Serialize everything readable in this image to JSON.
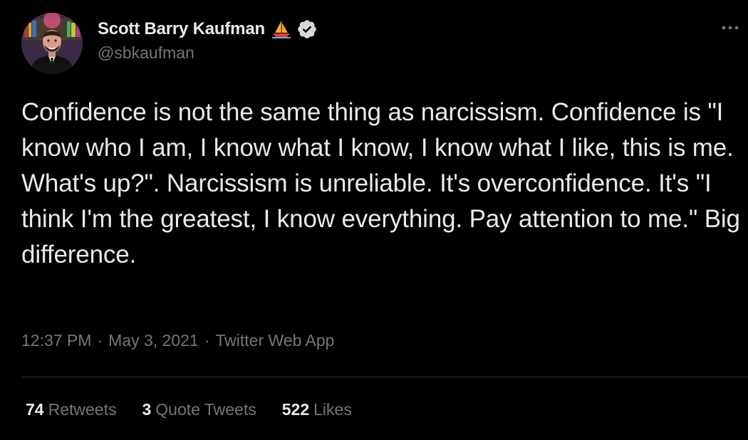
{
  "author": {
    "display_name": "Scott Barry Kaufman",
    "handle": "@sbkaufman",
    "name_emoji_icon": "sailboat-icon",
    "verified_icon": "verified-badge-icon"
  },
  "more_button_icon": "more-dots-icon",
  "tweet": {
    "text": "Confidence is not the same thing as narcissism. Confidence is \"I know who I am, I know what I know, I know what I like, this is me. What's up?\". Narcissism is unreliable. It's overconfidence. It's \"I think I'm the greatest, I know everything. Pay attention to me.\" Big difference."
  },
  "meta": {
    "time": "12:37 PM",
    "separator": "·",
    "date": "May 3, 2021",
    "source": "Twitter Web App"
  },
  "stats": {
    "retweets_count": "74",
    "retweets_label": "Retweets",
    "quotes_count": "3",
    "quotes_label": "Quote Tweets",
    "likes_count": "522",
    "likes_label": "Likes"
  },
  "colors": {
    "background": "#000000",
    "primary_text": "#e7e9ea",
    "secondary_text": "#71767b",
    "divider": "#2f3336"
  }
}
